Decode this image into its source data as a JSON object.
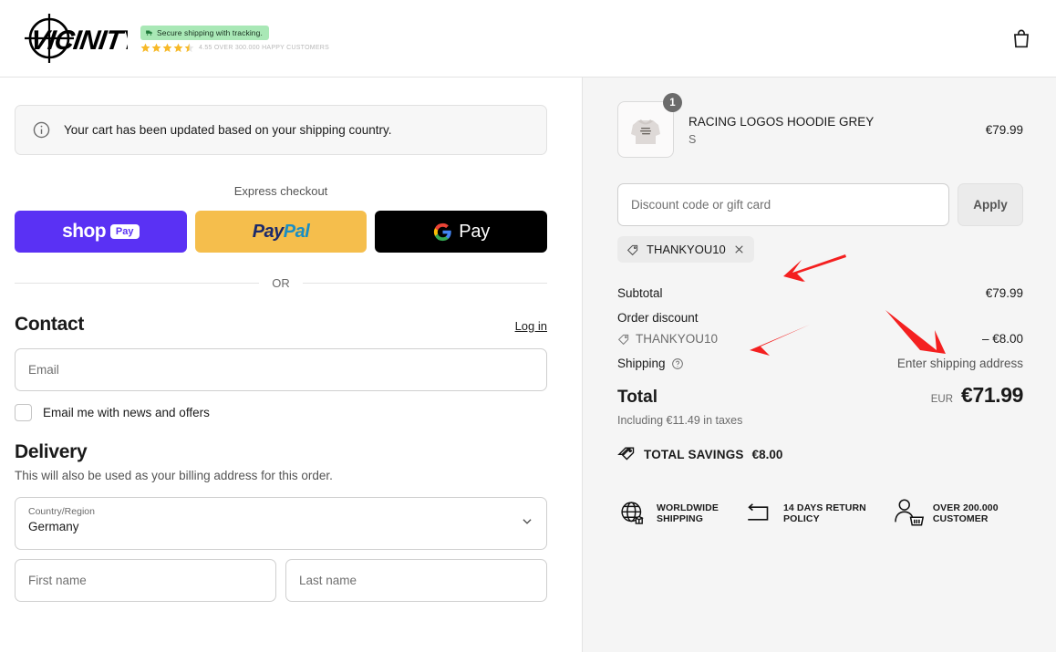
{
  "header": {
    "logo_text": "VICINITY",
    "secure_badge": "Secure shipping with  tracking.",
    "rating_text": "4.55 OVER 300.000 HAPPY CUSTOMERS",
    "stars": "4.5",
    "cart_icon": "shopping-bag-icon"
  },
  "notice": {
    "icon": "info-circle-icon",
    "text": "Your cart has been updated based on your shipping country."
  },
  "express": {
    "label": "Express checkout",
    "buttons": [
      {
        "name": "shop-pay",
        "word": "shop",
        "chip": "Pay",
        "color": "#5a31f4"
      },
      {
        "name": "paypal",
        "word1": "Pay",
        "word2": "Pal",
        "color": "#f5be4c"
      },
      {
        "name": "google-pay",
        "word": "Pay",
        "color": "#000000"
      }
    ]
  },
  "divider": {
    "text": "OR"
  },
  "contact": {
    "title": "Contact",
    "login_label": "Log in",
    "email_placeholder": "Email",
    "email_value": "",
    "newsletter_label": "Email me with news and offers",
    "newsletter_checked": false
  },
  "delivery": {
    "title": "Delivery",
    "subtitle": "This will also be used as your billing address for this order.",
    "country_label": "Country/Region",
    "country_value": "Germany",
    "first_name_placeholder": "First name",
    "first_name_value": "",
    "last_name_placeholder": "Last name",
    "last_name_value": ""
  },
  "summary": {
    "product": {
      "title": "RACING LOGOS HOODIE GREY",
      "variant": "S",
      "price": "€79.99",
      "quantity": "1"
    },
    "discount": {
      "placeholder": "Discount code or gift card",
      "value": "",
      "apply_label": "Apply",
      "applied_code": "THANKYOU10"
    },
    "lines": [
      {
        "label": "Subtotal",
        "value": "€79.99"
      },
      {
        "label": "Order discount",
        "value": ""
      },
      {
        "label": "THANKYOU10",
        "value": "– €8.00",
        "muted": true,
        "tag": true
      },
      {
        "label": "Shipping",
        "value": "Enter shipping address",
        "info": true,
        "muted_value": true
      }
    ],
    "subtotal_label": "Subtotal",
    "subtotal_value": "€79.99",
    "order_discount_label": "Order discount",
    "discount_code_label": "THANKYOU10",
    "discount_amount": "– €8.00",
    "shipping_label": "Shipping",
    "shipping_value": "Enter shipping address",
    "total_label": "Total",
    "currency": "EUR",
    "total_amount": "€71.99",
    "tax_note": "Including €11.49 in taxes",
    "savings_label": "TOTAL SAVINGS",
    "savings_amount": "€8.00"
  },
  "trust_badges": [
    {
      "icon": "globe-box-icon",
      "text": "WORLDWIDE\nSHIPPING"
    },
    {
      "icon": "return-arrow-icon",
      "text": "14 DAYS RETURN\nPOLICY"
    },
    {
      "icon": "customer-basket-icon",
      "text": "OVER 200.000\nCUSTOMER"
    }
  ],
  "annotations": {
    "arrow_color": "#f42020",
    "count": 3
  },
  "colors": {
    "shop_pay": "#5a31f4",
    "paypal": "#f5be4c",
    "gpay": "#000000",
    "panel_bg": "#f5f5f5",
    "badge_green": "#a9e8b6",
    "arrow_red": "#f42020"
  }
}
